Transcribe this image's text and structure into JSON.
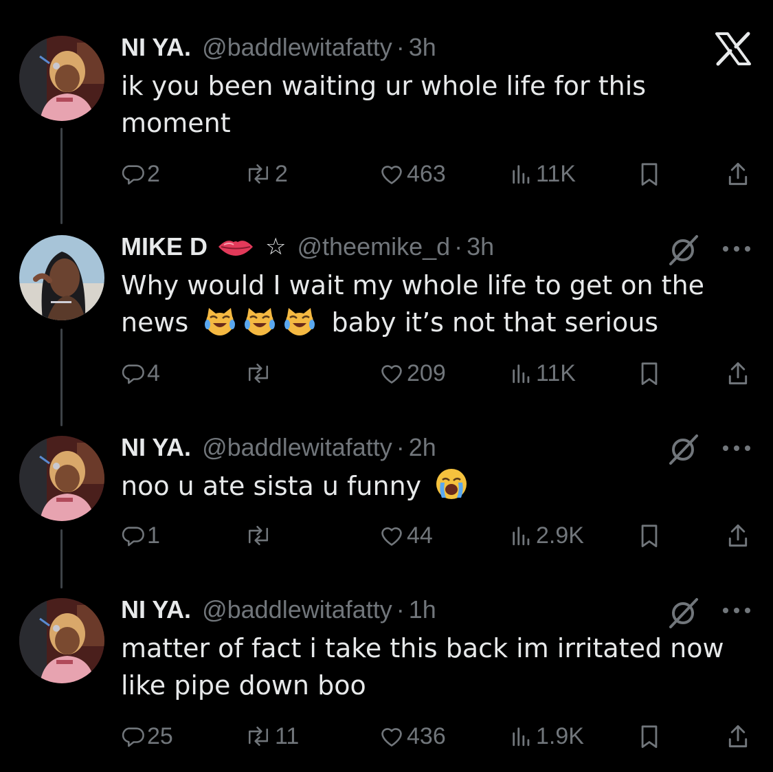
{
  "tweets": [
    {
      "display_name": "NI YA.",
      "handle": "@baddlewitafatty",
      "separator": "·",
      "time": "3h",
      "text": "ik you been waiting ur whole life for this moment",
      "replies": "2",
      "retweets": "2",
      "likes": "463",
      "views": "11K"
    },
    {
      "display_name": "MIKE D",
      "handle": "@theemike_d",
      "separator": "·",
      "time": "3h",
      "text_before": "Why would I wait my whole life to get on the news",
      "text_after": "baby it’s not that serious",
      "replies": "4",
      "retweets": "",
      "likes": "209",
      "views": "11K"
    },
    {
      "display_name": "NI YA.",
      "handle": "@baddlewitafatty",
      "separator": "·",
      "time": "2h",
      "text": "noo u ate sista u funny",
      "replies": "1",
      "retweets": "",
      "likes": "44",
      "views": "2.9K"
    },
    {
      "display_name": "NI YA.",
      "handle": "@baddlewitafatty",
      "separator": "·",
      "time": "1h",
      "text": "matter of fact i take this back im irritated now like pipe down boo",
      "replies": "25",
      "retweets": "11",
      "likes": "436",
      "views": "1.9K"
    }
  ],
  "icons": {
    "reply": "reply-icon",
    "retweet": "retweet-icon",
    "like": "heart-icon",
    "views": "views-icon",
    "bookmark": "bookmark-icon",
    "share": "share-icon",
    "logo": "x-logo-icon",
    "grok": "grok-icon",
    "more": "more-icon",
    "lips": "lips-emoji",
    "star": "star-icon",
    "crying_cat": "crying-cat-emoji",
    "sob": "loudly-crying-face-emoji"
  },
  "colors": {
    "background": "#000000",
    "text": "#e7e9ea",
    "muted": "#71767b",
    "thread_line": "#3d4247"
  }
}
